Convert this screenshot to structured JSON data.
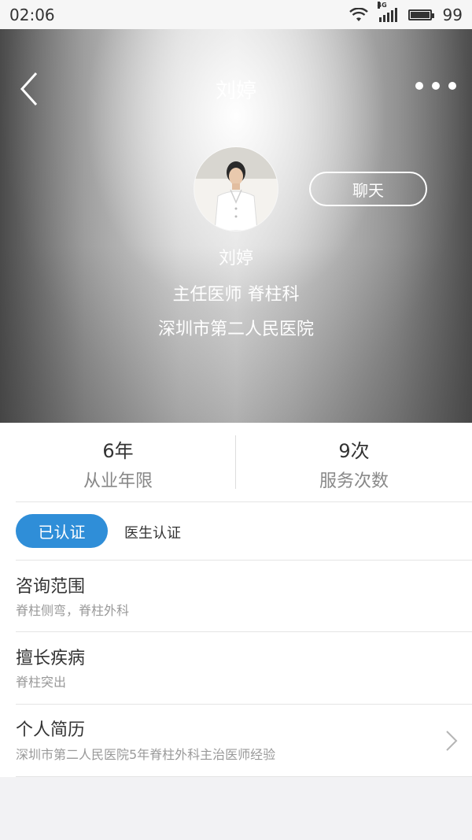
{
  "status": {
    "time": "02:06",
    "network": "4G",
    "battery": "99"
  },
  "header": {
    "title": "刘婷"
  },
  "doctor": {
    "chat_label": "聊天",
    "name": "刘婷",
    "title_dept": "主任医师 脊柱科",
    "hospital": "深圳市第二人民医院"
  },
  "stats": [
    {
      "value": "6年",
      "label": "从业年限"
    },
    {
      "value": "9次",
      "label": "服务次数"
    }
  ],
  "certification": {
    "badge": "已认证",
    "label": "医生认证"
  },
  "sections": [
    {
      "title": "咨询范围",
      "subtitle": "脊柱侧弯，脊柱外科"
    },
    {
      "title": "擅长疾病",
      "subtitle": "脊柱突出"
    },
    {
      "title": "个人简历",
      "subtitle": "深圳市第二人民医院5年脊柱外科主治医师经验"
    }
  ],
  "colors": {
    "accent": "#2f8ed8"
  }
}
